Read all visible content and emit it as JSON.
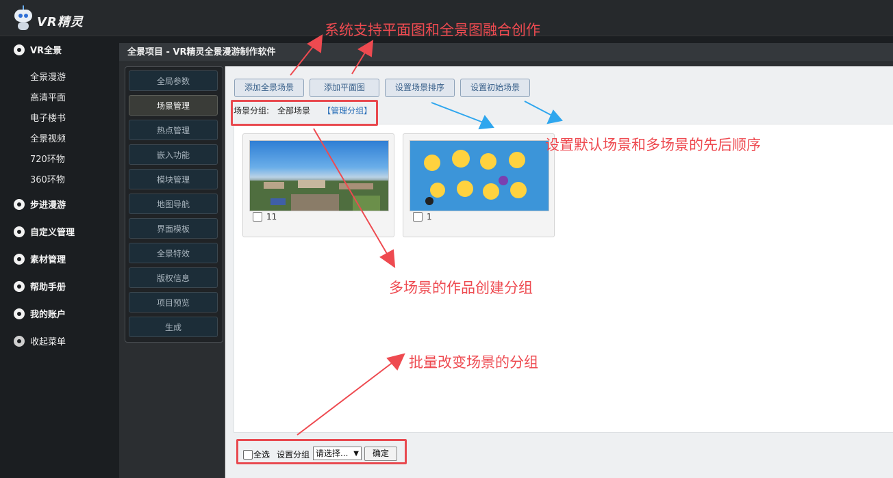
{
  "app": {
    "logo_text": "VR精灵"
  },
  "sidebar": {
    "sections": [
      {
        "label": "VR全景",
        "icon": "camera-icon"
      },
      {
        "label": "步进漫游",
        "icon": "walk-icon"
      },
      {
        "label": "自定义管理",
        "icon": "custom-icon"
      },
      {
        "label": "素材管理",
        "icon": "folder-icon"
      },
      {
        "label": "帮助手册",
        "icon": "help-icon"
      },
      {
        "label": "我的账户",
        "icon": "user-icon"
      },
      {
        "label": "收起菜单",
        "icon": "collapse-left-icon"
      }
    ],
    "sub_items": [
      "全景漫游",
      "高清平面",
      "电子楼书",
      "全景视频",
      "720环物",
      "360环物"
    ]
  },
  "panel": {
    "title": "全景项目 - VR精灵全景漫游制作软件"
  },
  "tabs": [
    "全局参数",
    "场景管理",
    "热点管理",
    "嵌入功能",
    "模块管理",
    "地图导航",
    "界面模板",
    "全景特效",
    "版权信息",
    "项目预览",
    "生成"
  ],
  "active_tab": "场景管理",
  "toolbar": {
    "add_panorama": "添加全景场景",
    "add_plan": "添加平面图",
    "set_order": "设置场景排序",
    "set_initial": "设置初始场景"
  },
  "group": {
    "label": "场景分组:",
    "current": "全部场景",
    "manage": "【管理分组】"
  },
  "scenes": [
    {
      "name": "11"
    },
    {
      "name": "1"
    }
  ],
  "bottom": {
    "select_all": "全选",
    "set_group": "设置分组",
    "select_placeholder": "请选择...",
    "confirm": "确定"
  },
  "annotations": {
    "top": "系统支持平面图和全景图融合创作",
    "order": "设置默认场景和多场景的先后顺序",
    "group": "多场景的作品创建分组",
    "batch": "批量改变场景的分组"
  },
  "colors": {
    "annotation_red": "#ee4a50",
    "annotation_blue": "#2ea6ee",
    "tab_active": "#3a3c38"
  }
}
